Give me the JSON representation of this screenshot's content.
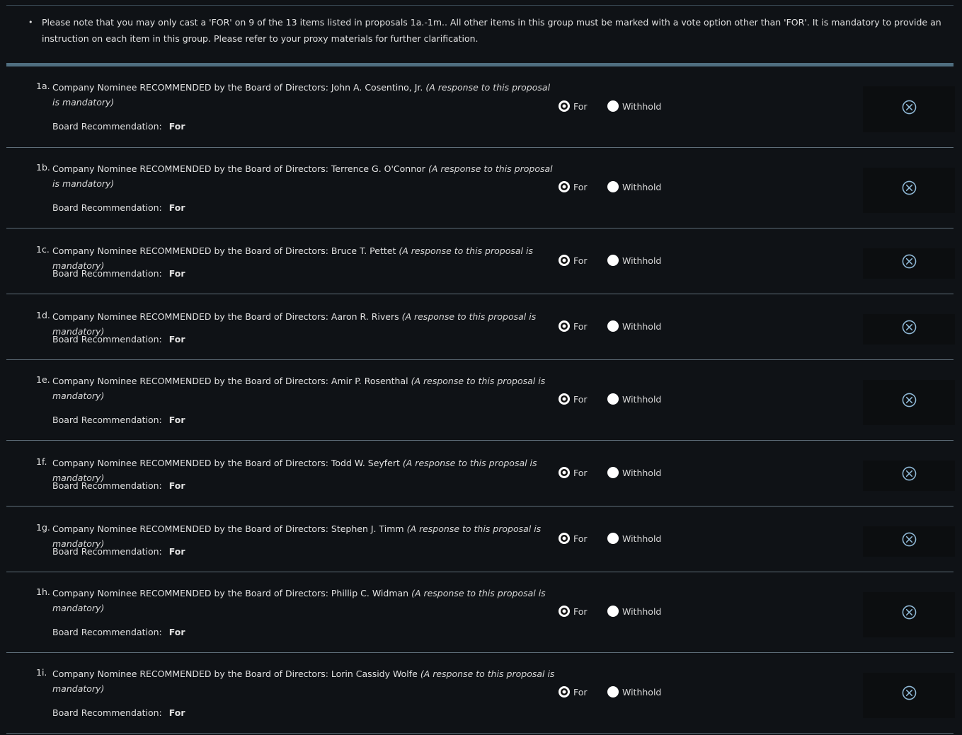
{
  "notice": {
    "bullet": "•",
    "text": "Please note that you may only cast a 'FOR' on 9 of the 13 items listed in proposals 1a.-1m.. All other items in this group must be marked with a vote option other than 'FOR'.  It is mandatory to provide an instruction on each item in this group.  Please refer to your proxy materials for further clarification."
  },
  "labels": {
    "board_rec": "Board Recommendation:",
    "for": "For",
    "withhold": "Withhold"
  },
  "colors": {
    "accent_bar": "#4f6e80",
    "clear_icon": "#8fb8d6",
    "background": "#0f1216"
  },
  "proposals": [
    {
      "num": "1a.",
      "desc": "Company Nominee RECOMMENDED by the Board of Directors: John A. Cosentino, Jr.",
      "mandatory": "(A response to this proposal is mandatory)",
      "recommendation": "For",
      "selected": "For"
    },
    {
      "num": "1b.",
      "desc": "Company Nominee RECOMMENDED by the Board of Directors: Terrence G. O'Connor",
      "mandatory": "(A response to this proposal is mandatory)",
      "recommendation": "For",
      "selected": "For"
    },
    {
      "num": "1c.",
      "desc": "Company Nominee RECOMMENDED by the Board of Directors: Bruce T. Pettet",
      "mandatory": "(A response to this proposal is mandatory)",
      "recommendation": "For",
      "selected": "For"
    },
    {
      "num": "1d.",
      "desc": "Company Nominee RECOMMENDED by the Board of Directors: Aaron R. Rivers",
      "mandatory": "(A response to this proposal is mandatory)",
      "recommendation": "For",
      "selected": "For"
    },
    {
      "num": "1e.",
      "desc": "Company Nominee RECOMMENDED by the Board of Directors: Amir P. Rosenthal",
      "mandatory": "(A response to this proposal is mandatory)",
      "recommendation": "For",
      "selected": "For"
    },
    {
      "num": "1f.",
      "desc": "Company Nominee RECOMMENDED by the Board of Directors: Todd W. Seyfert",
      "mandatory": "(A response to this proposal is mandatory)",
      "recommendation": "For",
      "selected": "For"
    },
    {
      "num": "1g.",
      "desc": "Company Nominee RECOMMENDED by the Board of Directors: Stephen J. Timm",
      "mandatory": "(A response to this proposal is mandatory)",
      "recommendation": "For",
      "selected": "For"
    },
    {
      "num": "1h.",
      "desc": "Company Nominee RECOMMENDED by the Board of Directors: Phillip C. Widman",
      "mandatory": "(A response to this proposal is mandatory)",
      "recommendation": "For",
      "selected": "For"
    },
    {
      "num": "1i.",
      "desc": "Company Nominee RECOMMENDED by the Board of Directors: Lorin Cassidy Wolfe",
      "mandatory": "(A response to this proposal is mandatory)",
      "recommendation": "For",
      "selected": "For"
    }
  ]
}
